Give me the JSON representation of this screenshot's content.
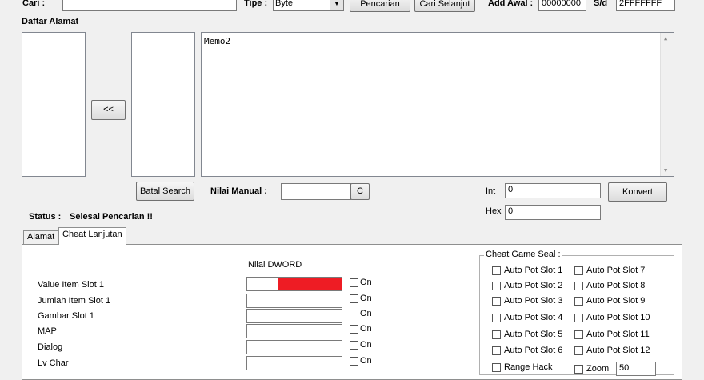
{
  "search_bar": {
    "cari_label": "Cari :",
    "cari_value": "",
    "tipe_label": "Tipe :",
    "tipe_value": "Byte",
    "pencarian_button": "Pencarian",
    "cari_selanjut_button": "Cari Selanjut",
    "add_awal_label": "Add Awal :",
    "add_awal_value": "00000000",
    "sd_label": "S/d",
    "sd_value": "2FFFFFFF"
  },
  "address_panel": {
    "title": "Daftar Alamat",
    "move_button": "<<",
    "memo_text": "Memo2",
    "batal_button": "Batal Search"
  },
  "manual": {
    "label": "Nilai Manual :",
    "value": "",
    "c_button": "C"
  },
  "converter": {
    "int_label": "Int",
    "int_value": "0",
    "hex_label": "Hex",
    "hex_value": "0",
    "konvert_button": "Konvert"
  },
  "status": {
    "label": "Status :",
    "value": "Selesai Pencarian !!"
  },
  "tabs": [
    {
      "label": "Alamat"
    },
    {
      "label": "Cheat Lanjutan"
    }
  ],
  "cheat": {
    "column_header": "Nilai DWORD",
    "on_label": "On",
    "rows": [
      {
        "label": "Value Item Slot 1"
      },
      {
        "label": "Jumlah Item Slot 1"
      },
      {
        "label": "Gambar  Slot 1"
      },
      {
        "label": "MAP"
      },
      {
        "label": "Dialog"
      },
      {
        "label": "Lv Char"
      }
    ],
    "highlight_color": "#ee1c24"
  },
  "game_seal": {
    "title": "Cheat Game Seal :",
    "left": [
      "Auto Pot Slot 1",
      "Auto Pot Slot 2",
      "Auto Pot Slot 3",
      "Auto Pot Slot 4",
      "Auto Pot Slot 5",
      "Auto Pot Slot 6",
      "Range Hack"
    ],
    "right": [
      "Auto Pot Slot 7",
      "Auto Pot Slot 8",
      "Auto Pot Slot 9",
      "Auto Pot Slot 10",
      "Auto Pot Slot 11",
      "Auto Pot Slot 12",
      "Zoom"
    ],
    "zoom_value": "50"
  }
}
